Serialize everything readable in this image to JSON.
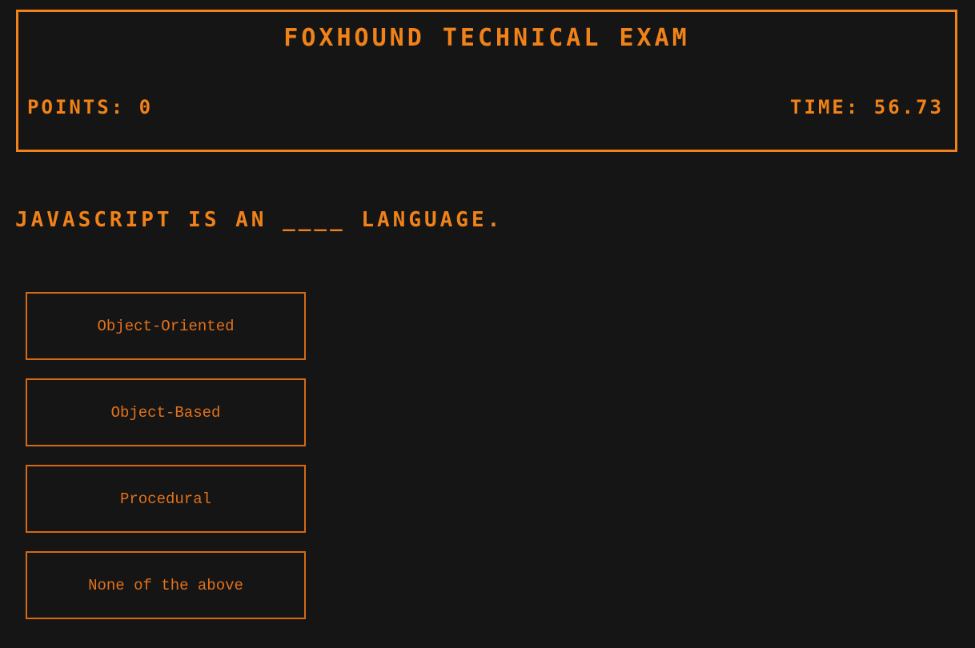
{
  "header": {
    "title": "Foxhound Technical Exam",
    "points_label": "Points: 0",
    "time_label": "Time: 56.73"
  },
  "quiz": {
    "question": "Javascript is an ____ language.",
    "answers": [
      {
        "label": "Object-Oriented"
      },
      {
        "label": "Object-Based"
      },
      {
        "label": "Procedural"
      },
      {
        "label": "None of the above"
      }
    ]
  },
  "colors": {
    "accent": "#f08219",
    "answer_border": "#d46a14",
    "background": "#151515"
  }
}
